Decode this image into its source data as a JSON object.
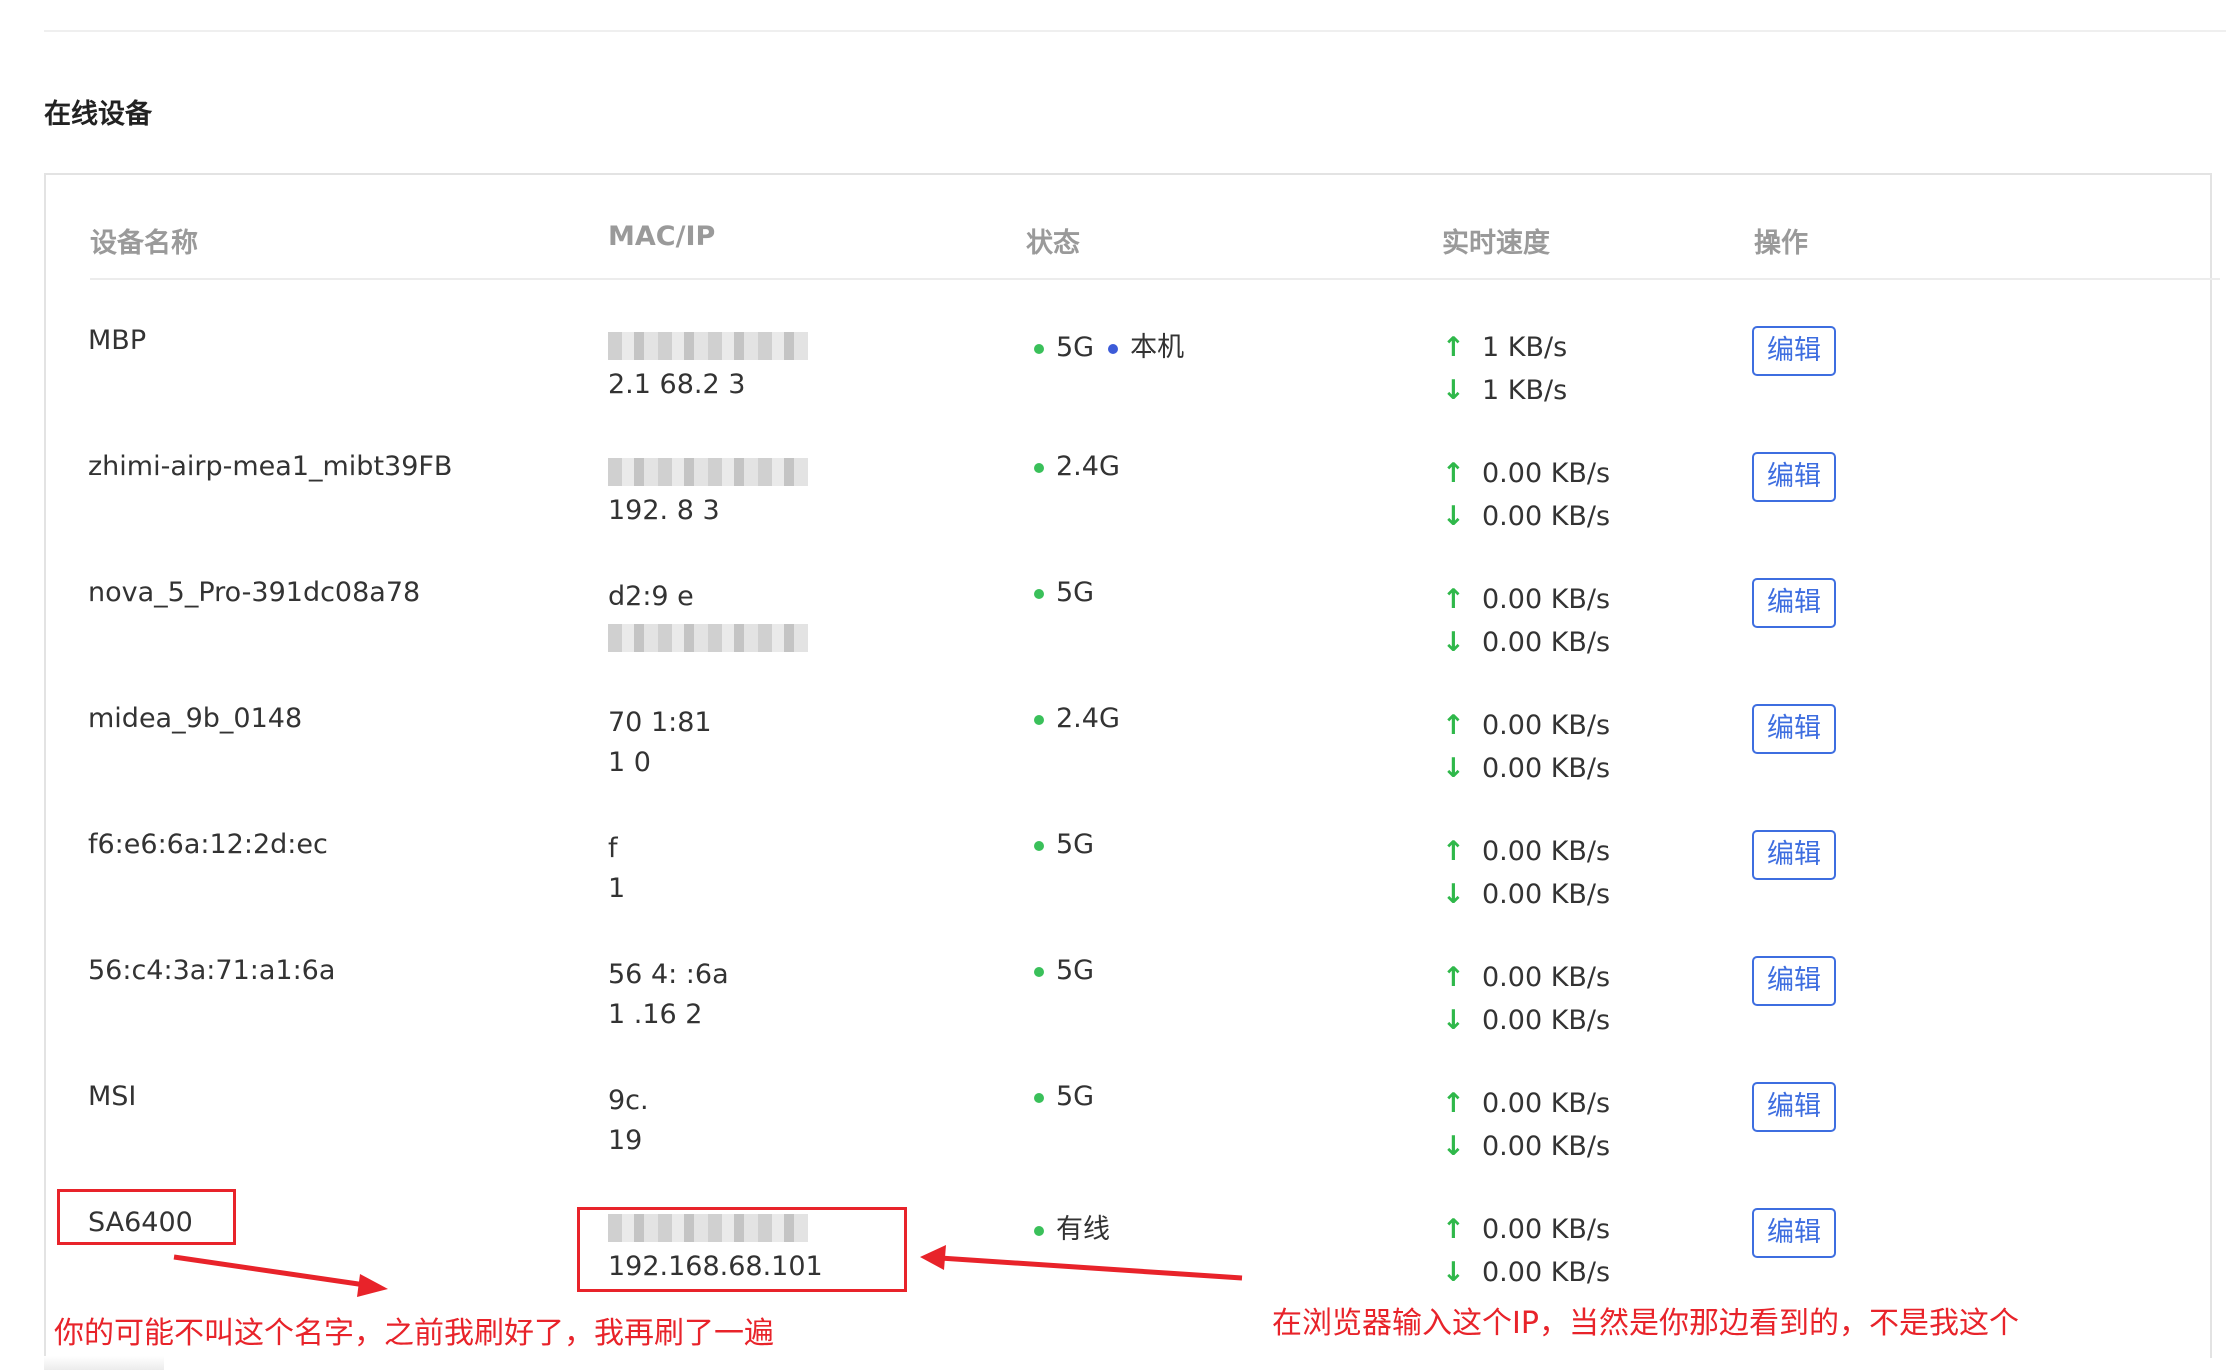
{
  "section_title": "在线设备",
  "columns": {
    "name": "设备名称",
    "mac_ip": "MAC/IP",
    "status": "状态",
    "speed": "实时速度",
    "action": "操作"
  },
  "edit_label": "编辑",
  "devices": [
    {
      "name": "MBP",
      "mac": "",
      "ip": "2.1  68.2 3",
      "band": "5G",
      "extra": "本机",
      "up": "1 KB/s",
      "down": "1 KB/s"
    },
    {
      "name": "zhimi-airp-mea1_mibt39FB",
      "mac": "fb",
      "ip": "192. 8 3",
      "band": "2.4G",
      "up": "0.00 KB/s",
      "down": "0.00 KB/s"
    },
    {
      "name": "nova_5_Pro-391dc08a78",
      "mac": "d2:9 e",
      "ip": "",
      "band": "5G",
      "up": "0.00 KB/s",
      "down": "0.00 KB/s"
    },
    {
      "name": "midea_9b_0148",
      "mac": "70 1:81",
      "ip": "1 0",
      "band": "2.4G",
      "up": "0.00 KB/s",
      "down": "0.00 KB/s"
    },
    {
      "name": "f6:e6:6a:12:2d:ec",
      "mac": "f",
      "ip": "1",
      "band": "5G",
      "up": "0.00 KB/s",
      "down": "0.00 KB/s"
    },
    {
      "name": "56:c4:3a:71:a1:6a",
      "mac": "56 4: :6a",
      "ip": "1 .16 2",
      "band": "5G",
      "up": "0.00 KB/s",
      "down": "0.00 KB/s"
    },
    {
      "name": "MSI",
      "mac": "9c.",
      "ip": "19",
      "band": "5G",
      "up": "0.00 KB/s",
      "down": "0.00 KB/s"
    },
    {
      "name": "SA6400",
      "mac": "",
      "ip": "192.168.68.101",
      "band": "有线",
      "up": "0.00 KB/s",
      "down": "0.00 KB/s"
    }
  ],
  "annotations": {
    "left_note": "你的可能不叫这个名字，之前我刷好了，我再刷了一遍",
    "right_note": "在浏览器输入这个IP，当然是你那边看到的，不是我这个",
    "color": "#e8232a"
  },
  "colors": {
    "accent": "#3e6ee0",
    "online": "#3ac05a",
    "self_dot": "#3c5bd8"
  }
}
